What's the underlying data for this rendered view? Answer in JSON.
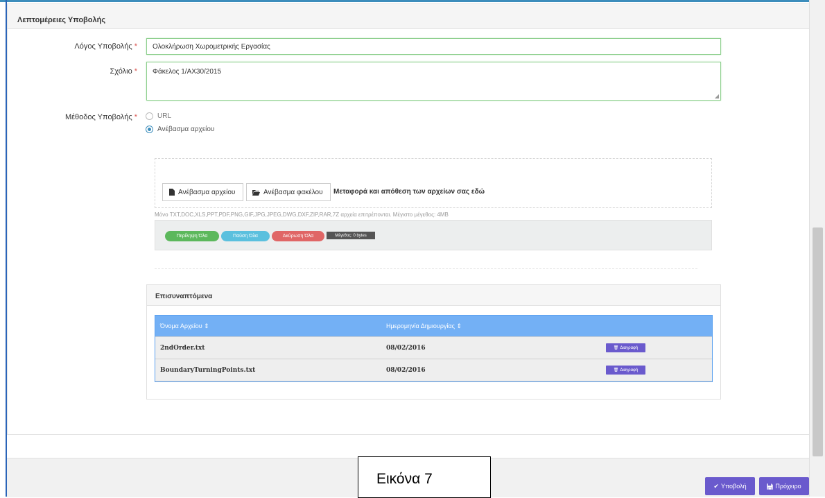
{
  "panel": {
    "title": "Λεπτομέρειες Υποβολής"
  },
  "form": {
    "reason": {
      "label": "Λόγος Υποβολής",
      "required_mark": "*",
      "value": "Ολοκλήρωση Χωρομετρικής Εργασίας"
    },
    "comment": {
      "label": "Σχόλιο",
      "required_mark": "*",
      "value": "Φάκελος 1/ΑΧ30/2015"
    },
    "method": {
      "label": "Μέθοδος Υποβολής",
      "required_mark": "*",
      "options": [
        {
          "label": "URL",
          "selected": false
        },
        {
          "label": "Ανέβασμα αρχείου",
          "selected": true
        }
      ]
    }
  },
  "upload": {
    "file_button": "Ανέβασμα αρχείου",
    "folder_button": "Ανέβασμα φακέλου",
    "drop_text": "Μεταφορά και απόθεση των αρχείων σας εδώ",
    "hint": "Μόνο TXT,DOC,XLS,PPT,PDF,PNG,GIF,JPG,JPEG,DWG,DXF,ZIP,RAR,7Z αρχεία επιτρέπονται. Μέγιστο μέγεθος: 4MB",
    "actions": {
      "send_all": "Περίληψη Όλα",
      "pause_all": "Παύση Όλα",
      "cancel_all": "Ακύρωση Όλα",
      "size": "Μέγεθος: 0 bytes"
    }
  },
  "attachments": {
    "title": "Επισυναπτόμενα",
    "columns": [
      "Όνομα Αρχείου ⇕",
      "Ημερομηνία Δημιουργίας ⇕"
    ],
    "rows": [
      {
        "name": "2ndOrder.txt",
        "date": "08/02/2016",
        "action": "Διαγραφή"
      },
      {
        "name": "BoundaryTurningPoints.txt",
        "date": "08/02/2016",
        "action": "Διαγραφή"
      }
    ]
  },
  "footer": {
    "submit": "Υποβολή",
    "draft": "Πρόχειρο"
  },
  "caption": "Εικόνα 7",
  "colors": {
    "accent_blue": "#3c8dbc",
    "table_header": "#73b0f5",
    "button_purple": "#6a5acd",
    "pill_green": "#5cb85c",
    "pill_blue": "#5bc0de",
    "pill_red": "#e06666"
  }
}
